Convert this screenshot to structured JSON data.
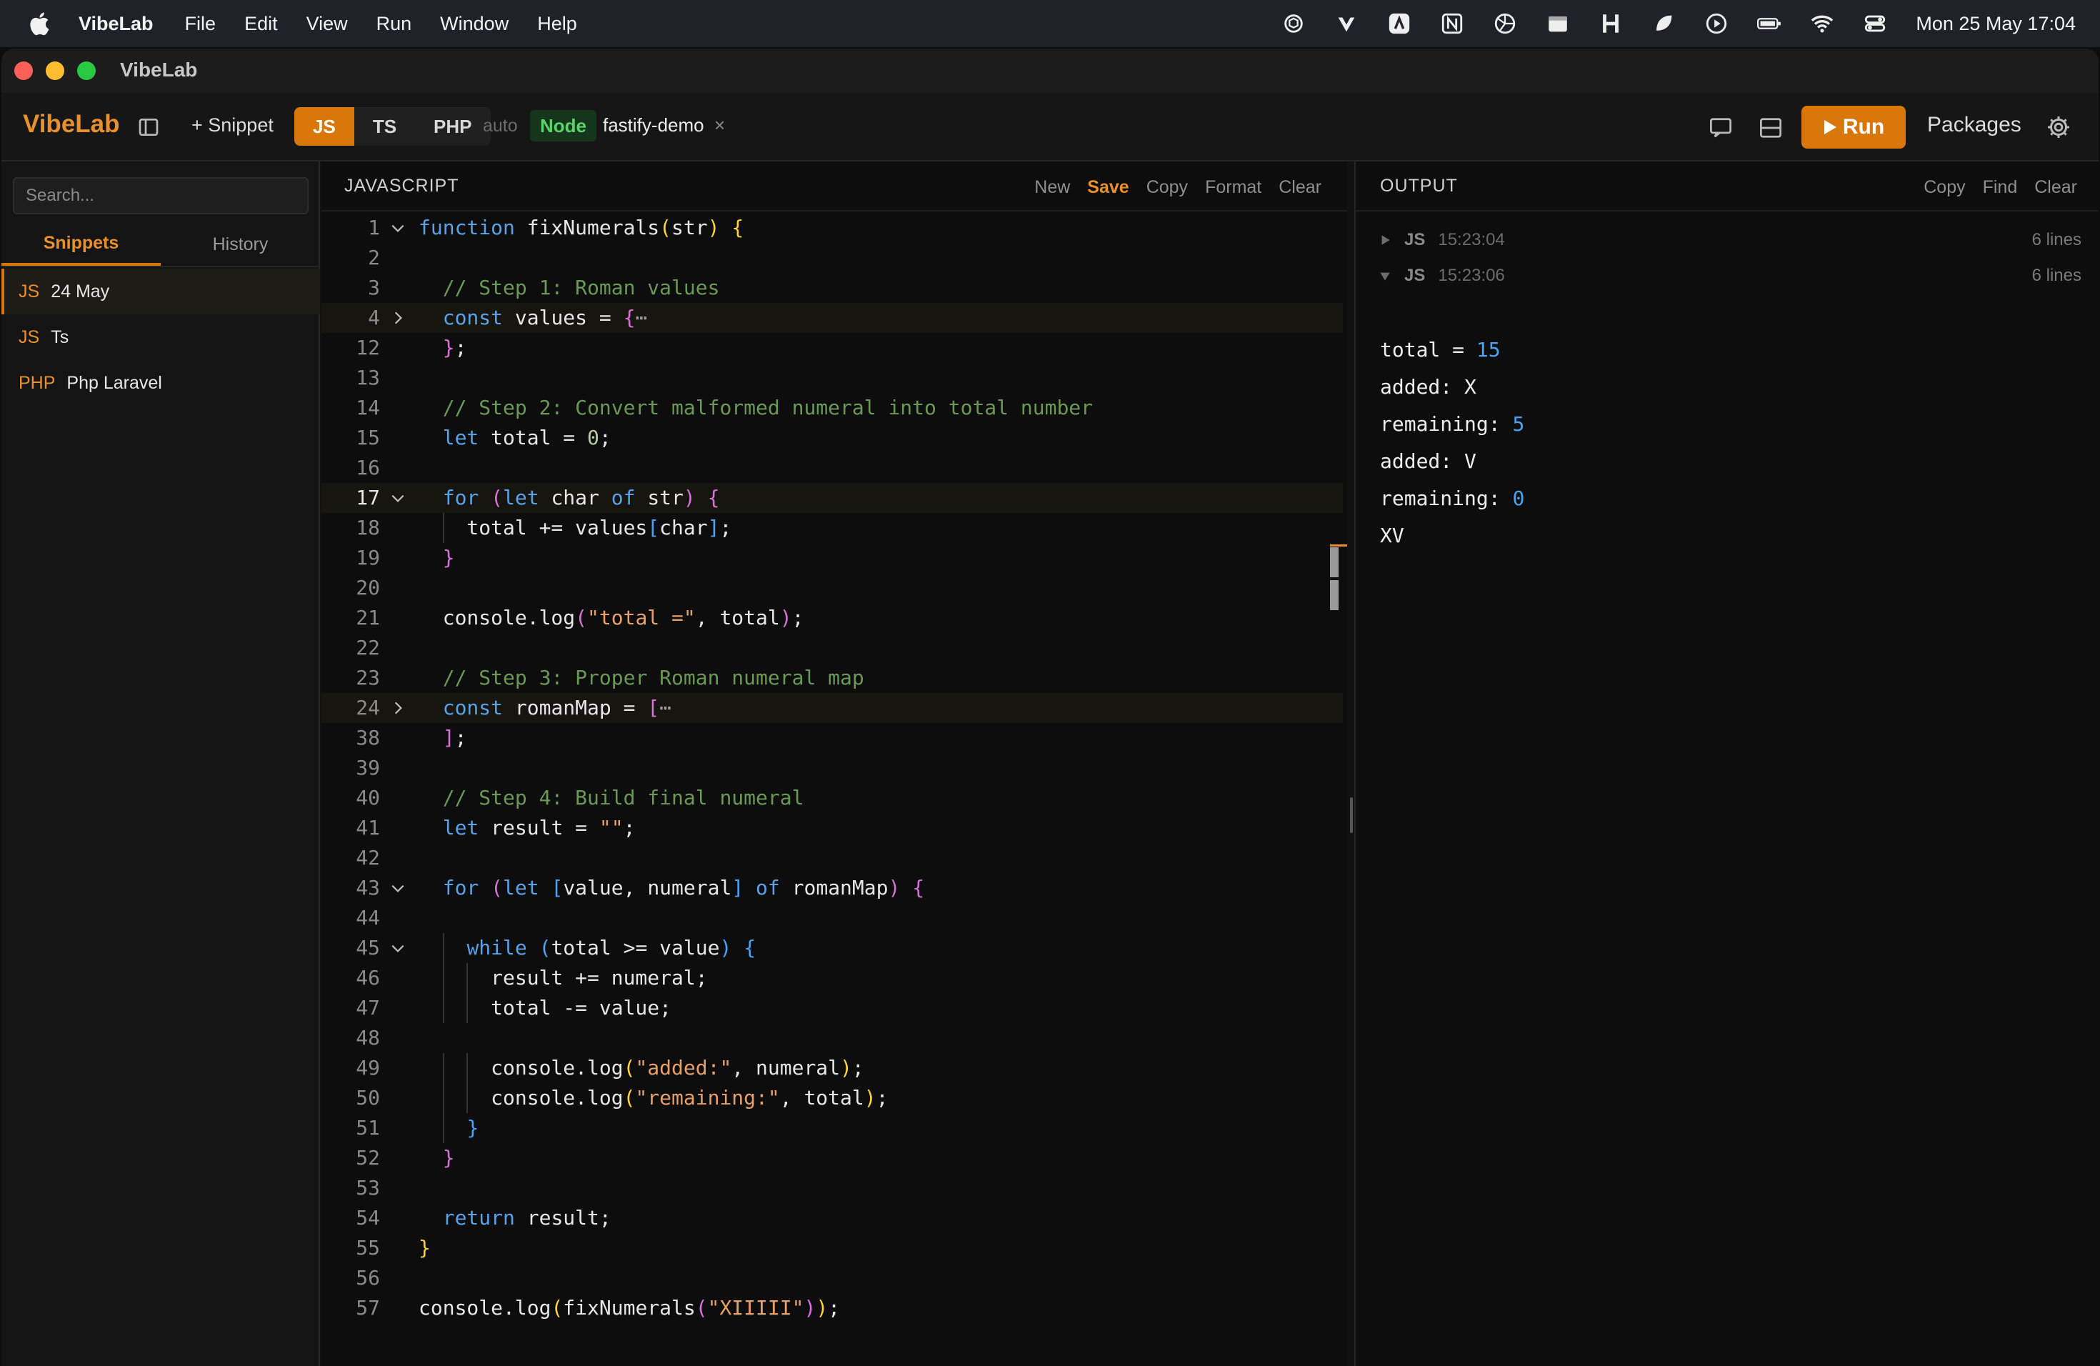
{
  "menubar": {
    "app": "VibeLab",
    "items": [
      "File",
      "Edit",
      "View",
      "Run",
      "Window",
      "Help"
    ],
    "clock": "Mon 25 May  17:04"
  },
  "window": {
    "title": "VibeLab"
  },
  "toolbar": {
    "brand": "VibeLab",
    "snippet_label": "+ Snippet",
    "langs": [
      "JS",
      "TS",
      "PHP"
    ],
    "mode": "auto",
    "runtime": "Node",
    "project": "fastify-demo",
    "close": "×",
    "run_label": "Run",
    "packages_label": "Packages",
    "accent": "#d9770b"
  },
  "sidebar": {
    "search_placeholder": "Search...",
    "tabs": [
      "Snippets",
      "History"
    ],
    "items": [
      {
        "lang": "JS",
        "name": "24 May"
      },
      {
        "lang": "JS",
        "name": "Ts"
      },
      {
        "lang": "PHP",
        "name": "Php Laravel"
      }
    ]
  },
  "editor": {
    "title": "JAVASCRIPT",
    "actions": [
      "New",
      "Save",
      "Copy",
      "Format",
      "Clear"
    ]
  },
  "output": {
    "title": "OUTPUT",
    "actions": [
      "Copy",
      "Find",
      "Clear"
    ],
    "runs": [
      {
        "lang": "JS",
        "time": "15:23:04",
        "lines": "6 lines"
      },
      {
        "lang": "JS",
        "time": "15:23:06",
        "lines": "6 lines"
      }
    ],
    "lines": [
      {
        "text": "total = ",
        "value": "15"
      },
      {
        "text": "added: X",
        "value": ""
      },
      {
        "text": "remaining: ",
        "value": "5"
      },
      {
        "text": "added: V",
        "value": ""
      },
      {
        "text": "remaining: ",
        "value": "0"
      },
      {
        "text": "XV",
        "value": ""
      }
    ]
  },
  "code": {
    "line_numbers": [
      "1",
      "2",
      "3",
      "4",
      "12",
      "13",
      "14",
      "15",
      "16",
      "17",
      "18",
      "19",
      "20",
      "21",
      "22",
      "23",
      "24",
      "38",
      "39",
      "40",
      "41",
      "42",
      "43",
      "44",
      "45",
      "46",
      "47",
      "48",
      "49",
      "50",
      "51",
      "52",
      "53",
      "54",
      "55",
      "56",
      "57"
    ],
    "lines": [
      "function fixNumerals(str) {",
      "",
      "  // Step 1: Roman values",
      "  const values = {⋯",
      "  };",
      "",
      "  // Step 2: Convert malformed numeral into total number",
      "  let total = 0;",
      "",
      "  for (let char of str) {",
      "    total += values[char];",
      "  }",
      "",
      "  console.log(\"total =\", total);",
      "",
      "  // Step 3: Proper Roman numeral map",
      "  const romanMap = [⋯",
      "  ];",
      "",
      "  // Step 4: Build final numeral",
      "  let result = \"\";",
      "",
      "  for (let [value, numeral] of romanMap) {",
      "",
      "    while (total >= value) {",
      "      result += numeral;",
      "      total -= value;",
      "",
      "      console.log(\"added:\", numeral);",
      "      console.log(\"remaining:\", total);",
      "    }",
      "  }",
      "",
      "  return result;",
      "}",
      "",
      "console.log(fixNumerals(\"XIIIII\"));"
    ]
  }
}
